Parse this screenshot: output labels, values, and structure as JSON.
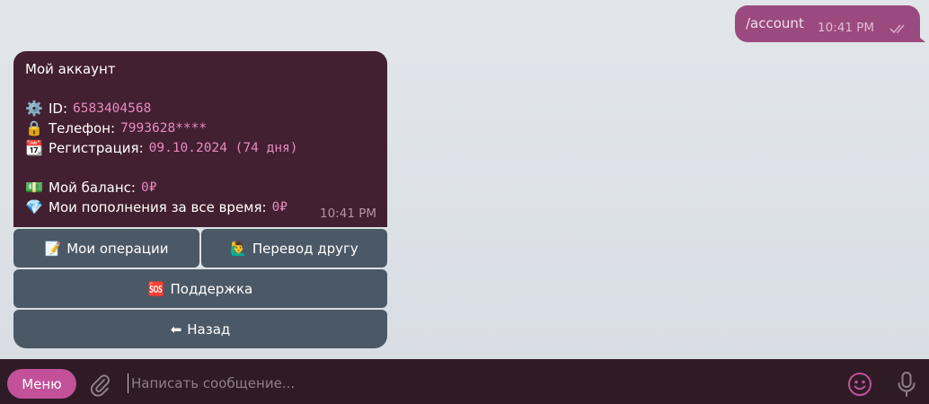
{
  "outgoing": {
    "text": "/account",
    "time": "10:41 PM"
  },
  "incoming": {
    "title": "Мой аккаунт",
    "id_label": "ID:",
    "id_value": "6583404568",
    "phone_label": "Телефон:",
    "phone_value": "7993628****",
    "reg_label": "Регистрация:",
    "reg_value": "09.10.2024 (74 дня)",
    "balance_label": "Мой баланс:",
    "balance_value": "0₽",
    "topups_label": "Мои пополнения за все время:",
    "topups_value": "0₽",
    "time": "10:41 PM",
    "emojis": {
      "id": "⚙️",
      "phone": "🔒",
      "reg": "📆",
      "balance": "💵",
      "topups": "💎"
    }
  },
  "keyboard": {
    "operations": {
      "icon": "📝",
      "label": "Мои операции"
    },
    "transfer": {
      "icon": "🙋‍♂️",
      "label": "Перевод другу"
    },
    "support": {
      "icon": "🆘",
      "label": "Поддержка"
    },
    "back": {
      "icon": "⬅",
      "label": "Назад"
    }
  },
  "compose": {
    "menu_label": "Меню",
    "placeholder": "Написать сообщение..."
  },
  "colors": {
    "outgoing_bubble": "#9b4a7f",
    "incoming_bubble": "#432031",
    "keyboard_button": "#4b5866",
    "menu_button": "#c2519a",
    "value_accent": "#e58ac0"
  },
  "icons": [
    "double-check-icon",
    "paperclip-icon",
    "smile-icon",
    "microphone-icon"
  ]
}
